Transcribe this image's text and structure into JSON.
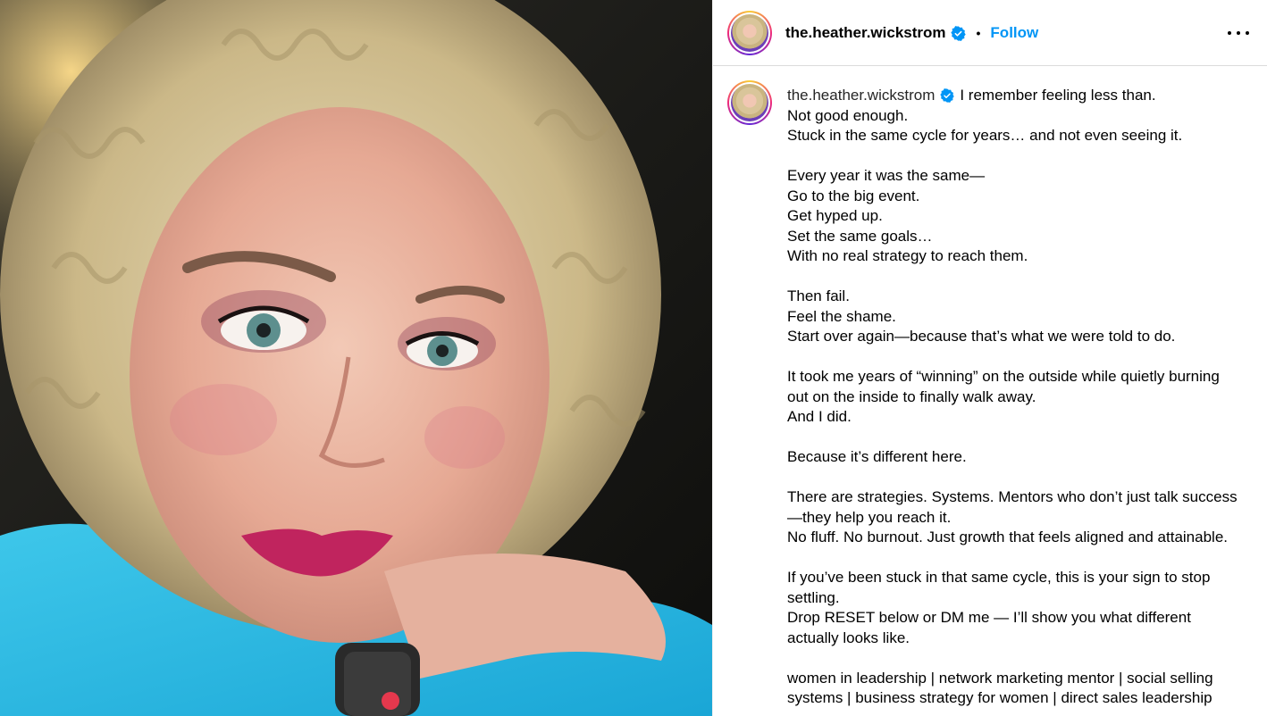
{
  "post": {
    "username": "the.heather.wickstrom",
    "follow_label": "Follow",
    "separator": "•",
    "caption_username": "the.heather.wickstrom",
    "caption_text": "I remember feeling less than.\nNot good enough.\nStuck in the same cycle for years… and not even seeing it.\n\nEvery year it was the same—\nGo to the big event.\nGet hyped up.\nSet the same goals…\nWith no real strategy to reach them.\n\nThen fail.\nFeel the shame.\nStart over again—because that’s what we were told to do.\n\nIt took me years of “winning” on the outside while quietly burning out on the inside to finally walk away.\nAnd I did.\n\nBecause it’s different here.\n\nThere are strategies. Systems. Mentors who don’t just talk success—they help you reach it.\nNo fluff. No burnout. Just growth that feels aligned and attainable.\n\nIf you’ve been stuck in that same cycle, this is your sign to stop settling.\nDrop RESET below or DM me — I’ll show you what different actually looks like.\n\nwomen in leadership | network marketing mentor | social selling systems | business strategy for women | direct sales leadership"
  },
  "icons": {
    "verified": "verified-badge-icon",
    "more": "more-options-icon"
  },
  "colors": {
    "follow": "#0095f6",
    "verified": "#0095f6"
  }
}
